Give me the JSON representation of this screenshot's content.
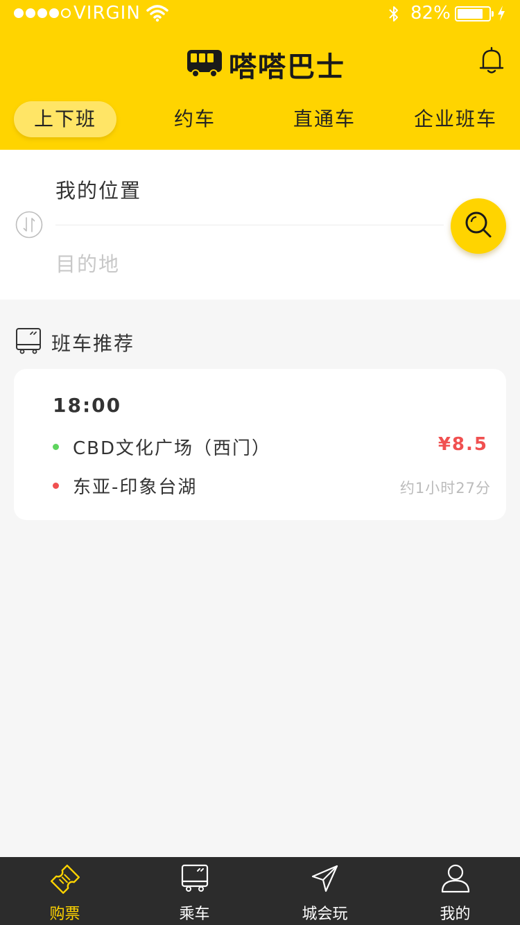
{
  "status_bar": {
    "carrier": "VIRGIN",
    "battery_percent": "82%",
    "battery_level": 0.82
  },
  "header": {
    "app_title": "嗒嗒巴士",
    "tabs": [
      {
        "label": "上下班",
        "active": true
      },
      {
        "label": "约车",
        "active": false
      },
      {
        "label": "直通车",
        "active": false
      },
      {
        "label": "企业班车",
        "active": false
      }
    ]
  },
  "search": {
    "from": "我的位置",
    "to_placeholder": "目的地"
  },
  "recommend": {
    "section_title": "班车推荐",
    "card": {
      "time": "18:00",
      "origin": "CBD文化广场（西门）",
      "destination": "东亚-印象台湖",
      "price": "¥8.5",
      "duration": "约1小时27分"
    }
  },
  "tabbar": {
    "items": [
      {
        "label": "购票",
        "icon": "ticket-icon",
        "active": true
      },
      {
        "label": "乘车",
        "icon": "bus-icon",
        "active": false
      },
      {
        "label": "城会玩",
        "icon": "paper-plane-icon",
        "active": false
      },
      {
        "label": "我的",
        "icon": "person-icon",
        "active": false
      }
    ]
  },
  "colors": {
    "brand_yellow": "#ffd400",
    "origin_dot": "#5ed45e",
    "destination_dot": "#f05050",
    "price": "#f05050"
  }
}
